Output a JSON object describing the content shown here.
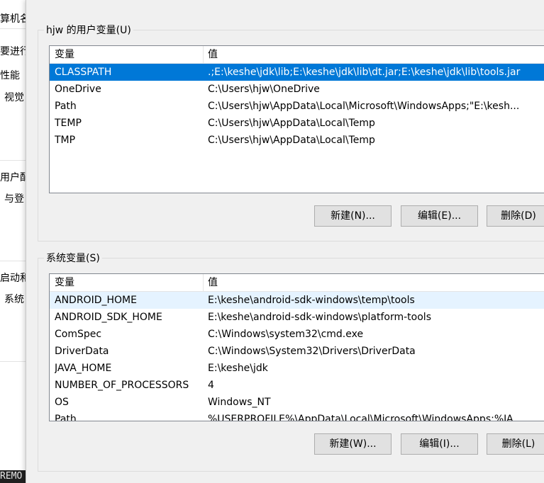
{
  "background_window": {
    "fragments": [
      "算机名",
      "要进行",
      "性能",
      "视觉",
      "用户配",
      "与登",
      "启动和",
      "系统",
      "REMO"
    ]
  },
  "user_vars": {
    "title": "hjw 的用户变量(U)",
    "columns": {
      "name": "变量",
      "value": "值"
    },
    "rows": [
      {
        "name": "CLASSPATH",
        "value": ".;E:\\keshe\\jdk\\lib;E:\\keshe\\jdk\\lib\\dt.jar;E:\\keshe\\jdk\\lib\\tools.jar"
      },
      {
        "name": "OneDrive",
        "value": "C:\\Users\\hjw\\OneDrive"
      },
      {
        "name": "Path",
        "value": "C:\\Users\\hjw\\AppData\\Local\\Microsoft\\WindowsApps;\"E:\\kesh..."
      },
      {
        "name": "TEMP",
        "value": "C:\\Users\\hjw\\AppData\\Local\\Temp"
      },
      {
        "name": "TMP",
        "value": "C:\\Users\\hjw\\AppData\\Local\\Temp"
      }
    ],
    "buttons": {
      "new": "新建(N)...",
      "edit": "编辑(E)...",
      "delete": "删除(D)"
    }
  },
  "system_vars": {
    "title": "系统变量(S)",
    "columns": {
      "name": "变量",
      "value": "值"
    },
    "rows": [
      {
        "name": "ANDROID_HOME",
        "value": "E:\\keshe\\android-sdk-windows\\temp\\tools"
      },
      {
        "name": "ANDROID_SDK_HOME",
        "value": "E:\\keshe\\android-sdk-windows\\platform-tools"
      },
      {
        "name": "ComSpec",
        "value": "C:\\Windows\\system32\\cmd.exe"
      },
      {
        "name": "DriverData",
        "value": "C:\\Windows\\System32\\Drivers\\DriverData"
      },
      {
        "name": "JAVA_HOME",
        "value": "E:\\keshe\\jdk"
      },
      {
        "name": "NUMBER_OF_PROCESSORS",
        "value": "4"
      },
      {
        "name": "OS",
        "value": "Windows_NT"
      },
      {
        "name": "Path",
        "value": "%USERPROFILE%\\AppData\\Local\\Microsoft\\WindowsApps;%JA..."
      }
    ],
    "buttons": {
      "new": "新建(W)...",
      "edit": "编辑(I)...",
      "delete": "删除(L)"
    }
  },
  "colors": {
    "selection": "#0078d7",
    "hover": "#e5f3ff",
    "dialog_bg": "#f0f0f0"
  }
}
